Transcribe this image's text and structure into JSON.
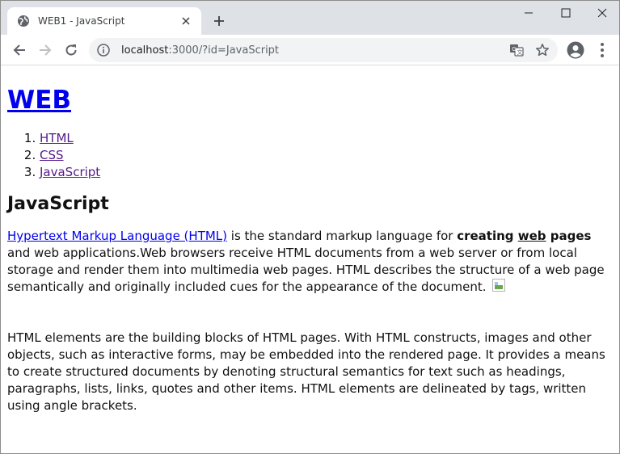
{
  "browser": {
    "tab_title": "WEB1 - JavaScript",
    "url_host": "localhost",
    "url_path": ":3000/?id=JavaScript",
    "icons": {
      "favicon": "globe-icon",
      "close": "close-icon",
      "new_tab": "plus-icon",
      "minimize": "minimize-icon",
      "maximize": "maximize-icon",
      "window_close": "close-icon",
      "back": "arrow-left-icon",
      "forward": "arrow-right-icon",
      "reload": "reload-icon",
      "site_info": "info-icon",
      "translate": "translate-icon",
      "bookmark": "star-icon",
      "profile": "account-circle-icon",
      "menu": "kebab-menu-icon"
    }
  },
  "page": {
    "heading": "WEB",
    "nav": [
      {
        "label": "HTML"
      },
      {
        "label": "CSS"
      },
      {
        "label": "JavaScript"
      }
    ],
    "title": "JavaScript",
    "p1": {
      "link": "Hypertext Markup Language (HTML)",
      "text_a": " is the standard markup language for ",
      "bold_a": "creating ",
      "bold_u": "web",
      "bold_b": " pages",
      "text_b": " and web applications.Web browsers receive HTML documents from a web server or from local storage and render them into multimedia web pages. HTML describes the structure of a web page semantically and originally included cues for the appearance of the document. "
    },
    "p2": "HTML elements are the building blocks of HTML pages. With HTML constructs, images and other objects, such as interactive forms, may be embedded into the rendered page. It provides a means to create structured documents by denoting structural semantics for text such as headings, paragraphs, lists, links, quotes and other items. HTML elements are delineated by tags, written using angle brackets."
  },
  "colors": {
    "link": "#0000ee",
    "visited": "#551a8b",
    "tabstrip": "#dee1e6",
    "omnibox": "#f1f3f4"
  }
}
